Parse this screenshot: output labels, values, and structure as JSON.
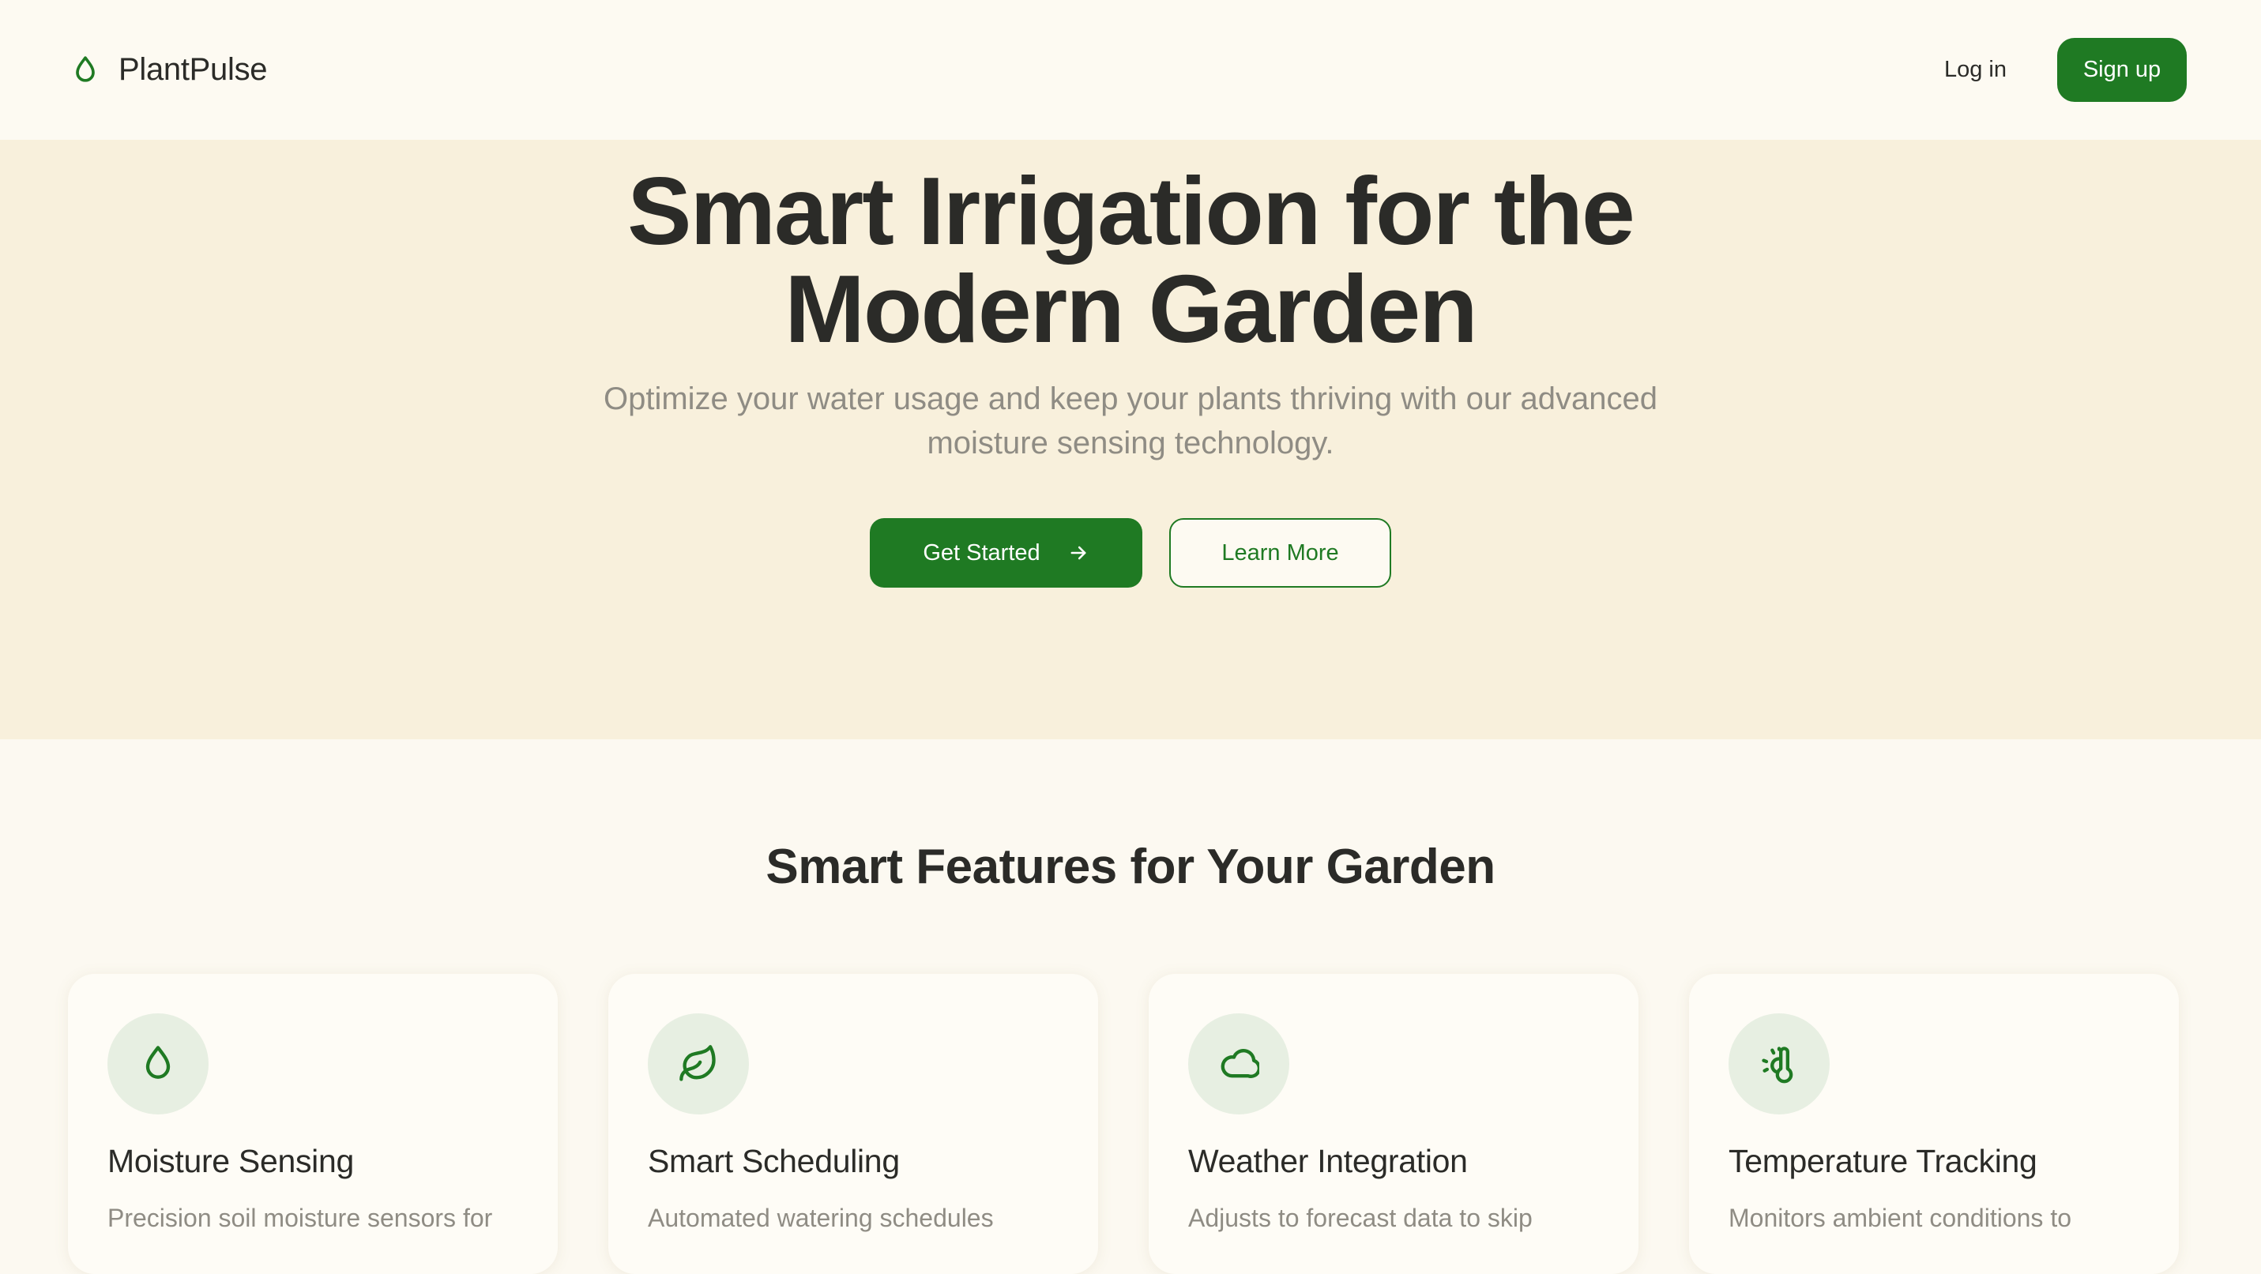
{
  "header": {
    "brand": "PlantPulse",
    "brand_icon": "droplet-icon",
    "login_label": "Log in",
    "signup_label": "Sign up"
  },
  "hero": {
    "title_line1": "Smart Irrigation for the",
    "title_line2": "Modern Garden",
    "subtitle_line1": "Optimize your water usage and keep your plants thriving with our advanced",
    "subtitle_line2": "moisture sensing technology.",
    "primary_label": "Get Started",
    "primary_icon": "arrow-right-icon",
    "secondary_label": "Learn More"
  },
  "features": {
    "title": "Smart Features for Your Garden",
    "cards": [
      {
        "icon": "droplet-icon",
        "title": "Moisture Sensing",
        "desc": "Precision soil moisture sensors for"
      },
      {
        "icon": "leaf-icon",
        "title": "Smart Scheduling",
        "desc": "Automated watering schedules"
      },
      {
        "icon": "cloud-icon",
        "title": "Weather Integration",
        "desc": "Adjusts to forecast data to skip"
      },
      {
        "icon": "thermometer-sun-icon",
        "title": "Temperature Tracking",
        "desc": "Monitors ambient conditions to"
      }
    ]
  },
  "colors": {
    "accent": "#1f7a23",
    "hero_bg": "#f8f0dc",
    "page_bg": "#fcf9f1",
    "icon_bg": "#e7efe2",
    "text": "#2b2b28",
    "muted": "#8f8c84"
  }
}
